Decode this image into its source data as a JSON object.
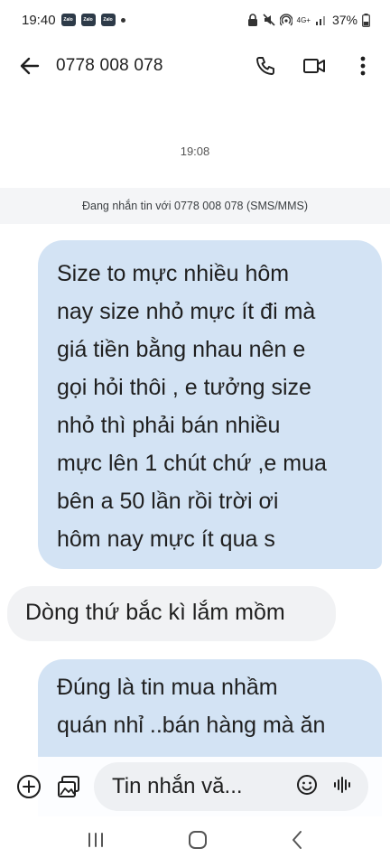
{
  "status_bar": {
    "time": "19:40",
    "notif_apps": [
      "Zalo",
      "Zalo",
      "Zalo"
    ],
    "network": "4G+",
    "battery": "37%"
  },
  "app_bar": {
    "title": "0778 008 078",
    "icons": [
      "back-arrow-icon",
      "phone-icon",
      "video-call-icon",
      "more-vert-icon"
    ]
  },
  "conversation": {
    "time_separator": "19:08",
    "info_banner": "Đang nhắn tin với 0778 008 078 (SMS/MMS)",
    "messages": [
      {
        "direction": "outgoing",
        "lines": [
          "Size to mực nhiều hôm",
          "nay size nhỏ mực ít đi mà",
          "giá tiền bằng nhau nên e",
          "gọi hỏi thôi , e tưởng size",
          "nhỏ thì phải bán nhiều",
          "mực lên 1 chút chứ ,e mua",
          "bên a 50 lần rồi trời ơi",
          "hôm nay mực ít qua s"
        ]
      },
      {
        "direction": "incoming",
        "lines": [
          "Dòng thứ bắc kì lắm mồm"
        ]
      },
      {
        "direction": "outgoing",
        "lines": [
          "Đúng là tin mua nhầm",
          "quán nhỉ ..bán hàng mà ăn"
        ]
      }
    ]
  },
  "composer": {
    "placeholder": "Tin nhắn vă...",
    "icons": [
      "add-icon",
      "gallery-icon",
      "emoji-icon",
      "voice-icon"
    ]
  },
  "nav_bar": {
    "icons": [
      "recents-icon",
      "home-icon",
      "back-icon"
    ]
  },
  "colors": {
    "outgoing_bubble": "#d3e3f4",
    "incoming_bubble": "#f1f2f4",
    "banner_bg": "#f4f5f7"
  }
}
